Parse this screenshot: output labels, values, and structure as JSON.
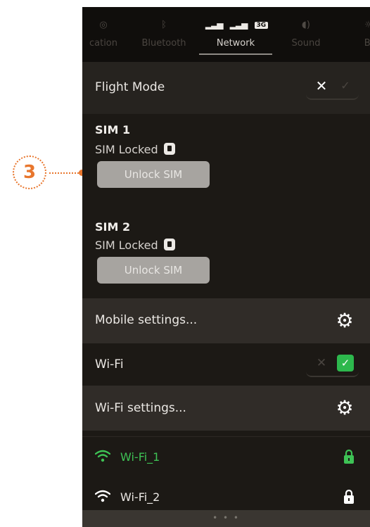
{
  "callout": {
    "number": "3"
  },
  "tabs": [
    {
      "label": "cation",
      "icon": "location-icon",
      "active": false
    },
    {
      "label": "Bluetooth",
      "icon": "bluetooth-icon",
      "active": false
    },
    {
      "label": "Network",
      "icon": "signal-icon",
      "active": true
    },
    {
      "label": "Sound",
      "icon": "speaker-icon",
      "active": false
    },
    {
      "label": "Bl",
      "icon": "brightness-icon",
      "active": false
    }
  ],
  "network_tab": {
    "signal_badge": "3G"
  },
  "flight_mode": {
    "label": "Flight Mode",
    "state": "off"
  },
  "sims": [
    {
      "title": "SIM 1",
      "status": "SIM Locked",
      "button": "Unlock SIM"
    },
    {
      "title": "SIM 2",
      "status": "SIM Locked",
      "button": "Unlock SIM"
    }
  ],
  "mobile_settings": {
    "label": "Mobile settings..."
  },
  "wifi": {
    "label": "Wi-Fi",
    "state": "on"
  },
  "wifi_settings": {
    "label": "Wi-Fi settings..."
  },
  "networks": [
    {
      "name": "Wi-Fi_1",
      "connected": true,
      "secured": true
    },
    {
      "name": "Wi-Fi_2",
      "connected": false,
      "secured": true
    }
  ],
  "colors": {
    "callout": "#e8762d",
    "background": "#1c1915",
    "toggle_on": "#2db84d",
    "connected": "#3ec255",
    "unlock_button": "#a7a4a0"
  }
}
